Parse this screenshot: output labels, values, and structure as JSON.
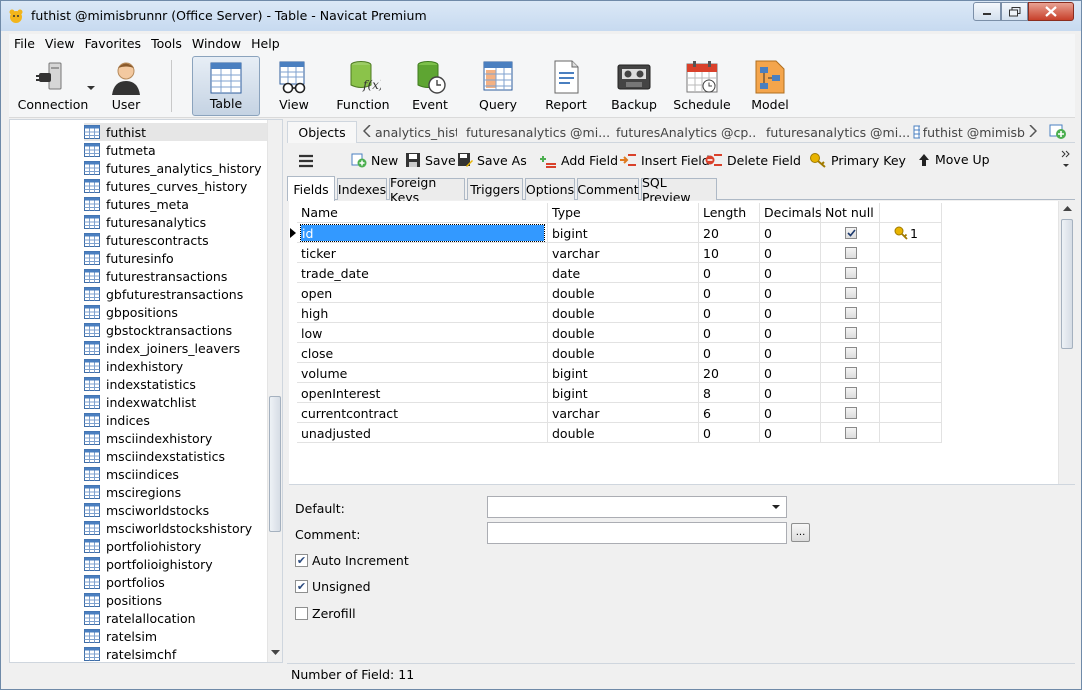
{
  "window": {
    "title": "futhist @mimisbrunnr (Office Server) - Table - Navicat Premium"
  },
  "menu": [
    "File",
    "View",
    "Favorites",
    "Tools",
    "Window",
    "Help"
  ],
  "toolbar": {
    "connection": "Connection",
    "user": "User",
    "table": "Table",
    "view": "View",
    "function": "Function",
    "event": "Event",
    "query": "Query",
    "report": "Report",
    "backup": "Backup",
    "schedule": "Schedule",
    "model": "Model"
  },
  "sidebar": {
    "selected": "futhist",
    "items": [
      "futhist",
      "futmeta",
      "futures_analytics_history",
      "futures_curves_history",
      "futures_meta",
      "futuresanalytics",
      "futurescontracts",
      "futuresinfo",
      "futurestransactions",
      "gbfuturestransactions",
      "gbpositions",
      "gbstocktransactions",
      "index_joiners_leavers",
      "indexhistory",
      "indexstatistics",
      "indexwatchlist",
      "indices",
      "msciindexhistory",
      "msciindexstatistics",
      "msciindices",
      "msciregions",
      "msciworldstocks",
      "msciworldstockshistory",
      "portfoliohistory",
      "portfolioighistory",
      "portfolios",
      "positions",
      "ratelallocation",
      "ratelsim",
      "ratelsimchf"
    ]
  },
  "tabs": {
    "objects": "Objects",
    "open": [
      "analytics_hist...",
      "futuresanalytics @mi...",
      "futuresAnalytics @cp...",
      "futuresanalytics @mi...",
      "futhist @mimisb"
    ]
  },
  "designer_toolbar": {
    "new": "New",
    "save": "Save",
    "save_as": "Save As",
    "add_field": "Add Field",
    "insert_field": "Insert Field",
    "delete_field": "Delete Field",
    "primary_key": "Primary Key",
    "move_up": "Move Up"
  },
  "subtabs": [
    "Fields",
    "Indexes",
    "Foreign Keys",
    "Triggers",
    "Options",
    "Comment",
    "SQL Preview"
  ],
  "grid": {
    "columns": [
      "Name",
      "Type",
      "Length",
      "Decimals",
      "Not null",
      ""
    ],
    "rows": [
      {
        "name": "id",
        "type": "bigint",
        "length": "20",
        "decimals": "0",
        "notnull": true,
        "key": "1"
      },
      {
        "name": "ticker",
        "type": "varchar",
        "length": "10",
        "decimals": "0",
        "notnull": false,
        "key": ""
      },
      {
        "name": "trade_date",
        "type": "date",
        "length": "0",
        "decimals": "0",
        "notnull": false,
        "key": ""
      },
      {
        "name": "open",
        "type": "double",
        "length": "0",
        "decimals": "0",
        "notnull": false,
        "key": ""
      },
      {
        "name": "high",
        "type": "double",
        "length": "0",
        "decimals": "0",
        "notnull": false,
        "key": ""
      },
      {
        "name": "low",
        "type": "double",
        "length": "0",
        "decimals": "0",
        "notnull": false,
        "key": ""
      },
      {
        "name": "close",
        "type": "double",
        "length": "0",
        "decimals": "0",
        "notnull": false,
        "key": ""
      },
      {
        "name": "volume",
        "type": "bigint",
        "length": "20",
        "decimals": "0",
        "notnull": false,
        "key": ""
      },
      {
        "name": "openInterest",
        "type": "bigint",
        "length": "8",
        "decimals": "0",
        "notnull": false,
        "key": ""
      },
      {
        "name": "currentcontract",
        "type": "varchar",
        "length": "6",
        "decimals": "0",
        "notnull": false,
        "key": ""
      },
      {
        "name": "unadjusted",
        "type": "double",
        "length": "0",
        "decimals": "0",
        "notnull": false,
        "key": ""
      }
    ]
  },
  "properties": {
    "default_label": "Default:",
    "comment_label": "Comment:",
    "ellipsis": "...",
    "auto_increment": "Auto Increment",
    "auto_increment_checked": true,
    "unsigned": "Unsigned",
    "unsigned_checked": true,
    "zerofill": "Zerofill",
    "zerofill_checked": false
  },
  "status": {
    "text": "Number of Field: 11"
  },
  "colors": {
    "selection": "#3399ff",
    "key_icon": "#e8b400"
  }
}
